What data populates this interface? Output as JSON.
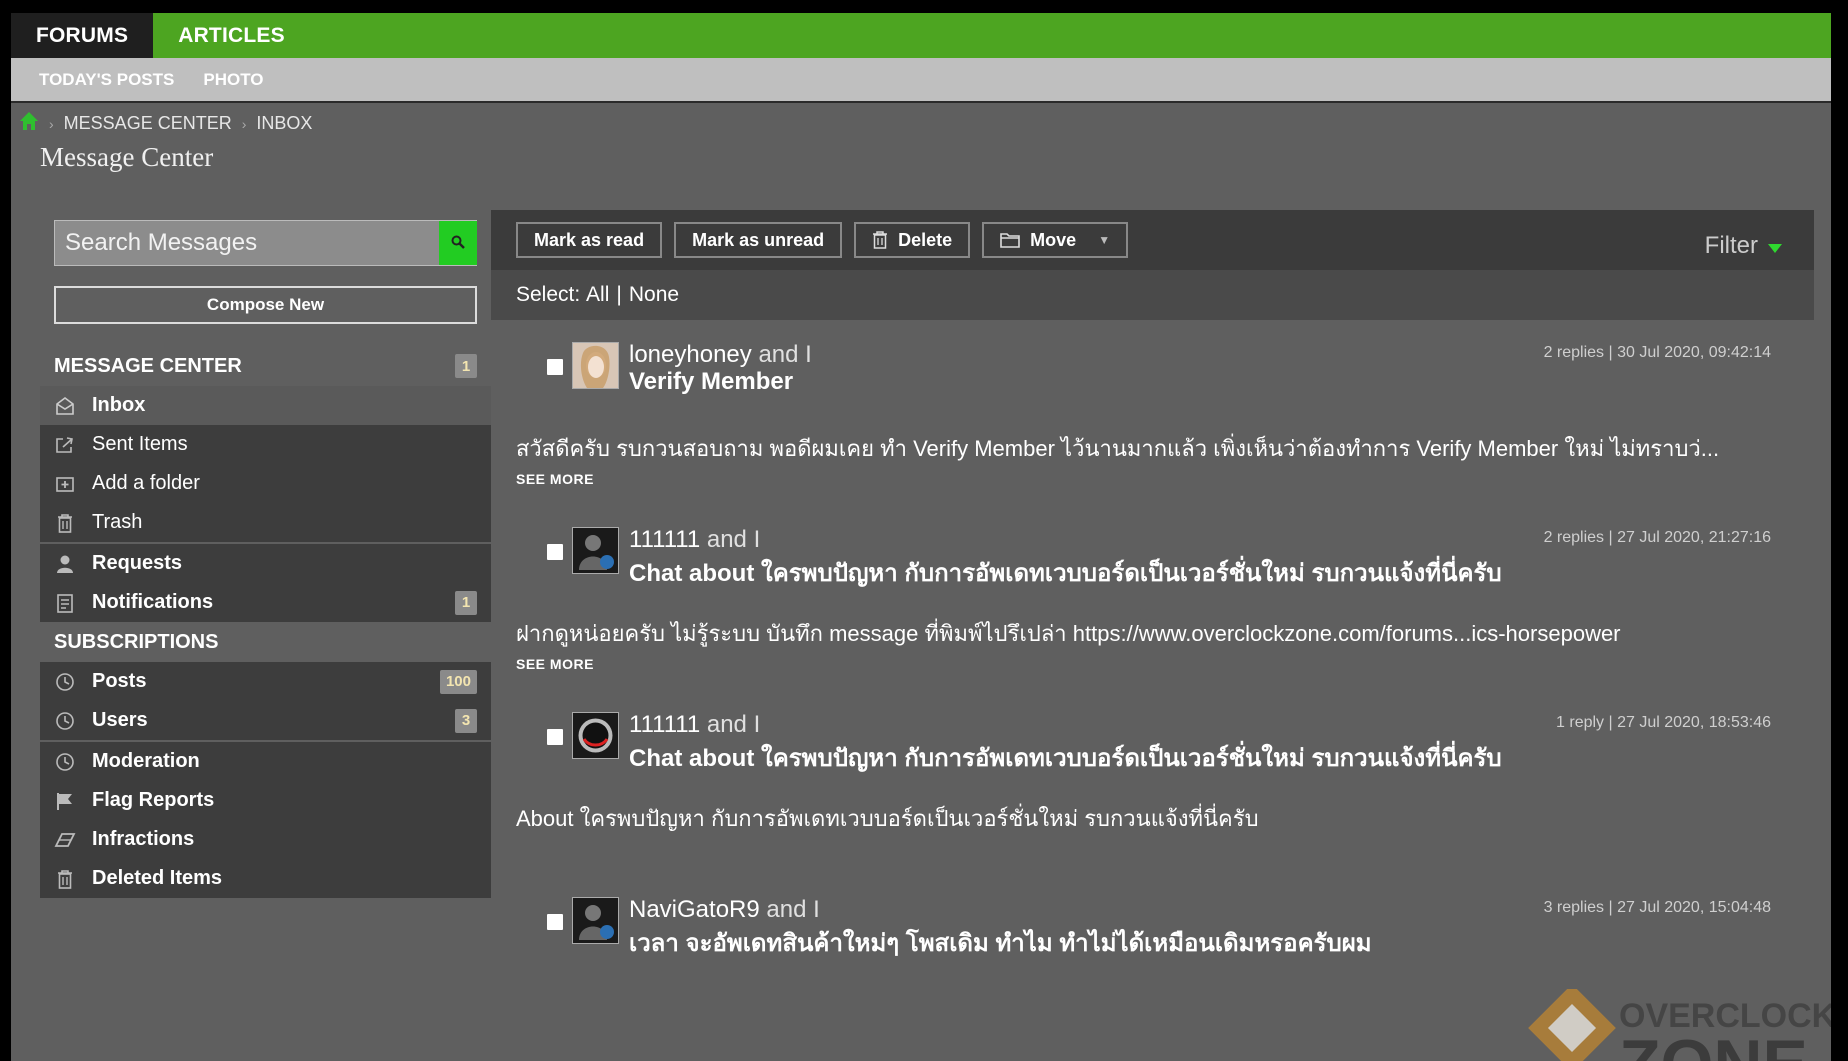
{
  "topnav": {
    "tabs": [
      {
        "label": "FORUMS"
      },
      {
        "label": "ARTICLES"
      }
    ]
  },
  "subnav": {
    "items": [
      {
        "label": "TODAY'S POSTS"
      },
      {
        "label": "PHOTO"
      }
    ]
  },
  "breadcrumb": {
    "items": [
      {
        "label": "MESSAGE CENTER"
      },
      {
        "label": "INBOX"
      }
    ]
  },
  "page": {
    "title": "Message Center"
  },
  "sidebar": {
    "search_placeholder": "Search Messages",
    "compose_label": "Compose New",
    "message_center": {
      "heading": "MESSAGE CENTER",
      "badge": "1"
    },
    "items": [
      {
        "label": "Inbox"
      },
      {
        "label": "Sent Items"
      },
      {
        "label": "Add a folder"
      },
      {
        "label": "Trash"
      },
      {
        "label": "Requests"
      },
      {
        "label": "Notifications",
        "badge": "1"
      }
    ],
    "subscriptions": {
      "heading": "SUBSCRIPTIONS"
    },
    "sub_items": [
      {
        "label": "Posts",
        "badge": "100"
      },
      {
        "label": "Users",
        "badge": "3"
      }
    ],
    "mod_items": [
      {
        "label": "Moderation"
      },
      {
        "label": "Flag Reports"
      },
      {
        "label": "Infractions"
      },
      {
        "label": "Deleted Items"
      }
    ]
  },
  "toolbar": {
    "mark_read": "Mark as read",
    "mark_unread": "Mark as unread",
    "delete": "Delete",
    "move": "Move",
    "filter": "Filter"
  },
  "select": {
    "label": "Select:",
    "all": "All",
    "separator": "|",
    "none": "None"
  },
  "messages": [
    {
      "user": "loneyhoney",
      "and": "and I",
      "subject": "Verify Member",
      "meta": "2 replies | 30 Jul 2020, 09:42:14",
      "preview": "สวัสดีครับ รบกวนสอบถาม พอดีผมเคย ทำ Verify Member ไว้นานมากแล้ว เพิ่งเห็นว่าต้องทำการ Verify Member ใหม่ ไม่ทราบว่...",
      "see_more": "SEE MORE"
    },
    {
      "user": "111111",
      "and": "and I",
      "subject": "Chat about ใครพบปัญหา กับการอัพเดทเวบบอร์ดเป็นเวอร์ชั่นใหม่ รบกวนแจ้งที่นี่ครับ",
      "meta": "2 replies | 27 Jul 2020, 21:27:16",
      "preview": "ฝากดูหน่อยครับ ไม่รู้ระบบ บันทึก message ที่พิมพ์ไปรึเปล่า https://www.overclockzone.com/forums...ics-horsepower",
      "see_more": "SEE MORE"
    },
    {
      "user": "111111",
      "and": "and I",
      "subject": "Chat about ใครพบปัญหา กับการอัพเดทเวบบอร์ดเป็นเวอร์ชั่นใหม่ รบกวนแจ้งที่นี่ครับ",
      "meta": "1 reply | 27 Jul 2020, 18:53:46",
      "preview": "About ใครพบปัญหา กับการอัพเดทเวบบอร์ดเป็นเวอร์ชั่นใหม่ รบกวนแจ้งที่นี่ครับ",
      "see_more": ""
    },
    {
      "user": "NaviGatoR9",
      "and": "and I",
      "subject": "เวลา จะอัพเดทสินค้าใหม่ๆ โพสเดิม ทำไม ทำไม่ได้เหมือนเดิมหรอครับผม",
      "meta": "3 replies | 27 Jul 2020, 15:04:48",
      "preview": "",
      "see_more": ""
    }
  ],
  "watermark": {
    "line1": "OVERCLOCK",
    "line2": "ZONE"
  },
  "colors": {
    "green": "#4da521",
    "accent_green": "#22cc22",
    "panel": "#3d3d3d",
    "bg": "#5f5f5f"
  }
}
